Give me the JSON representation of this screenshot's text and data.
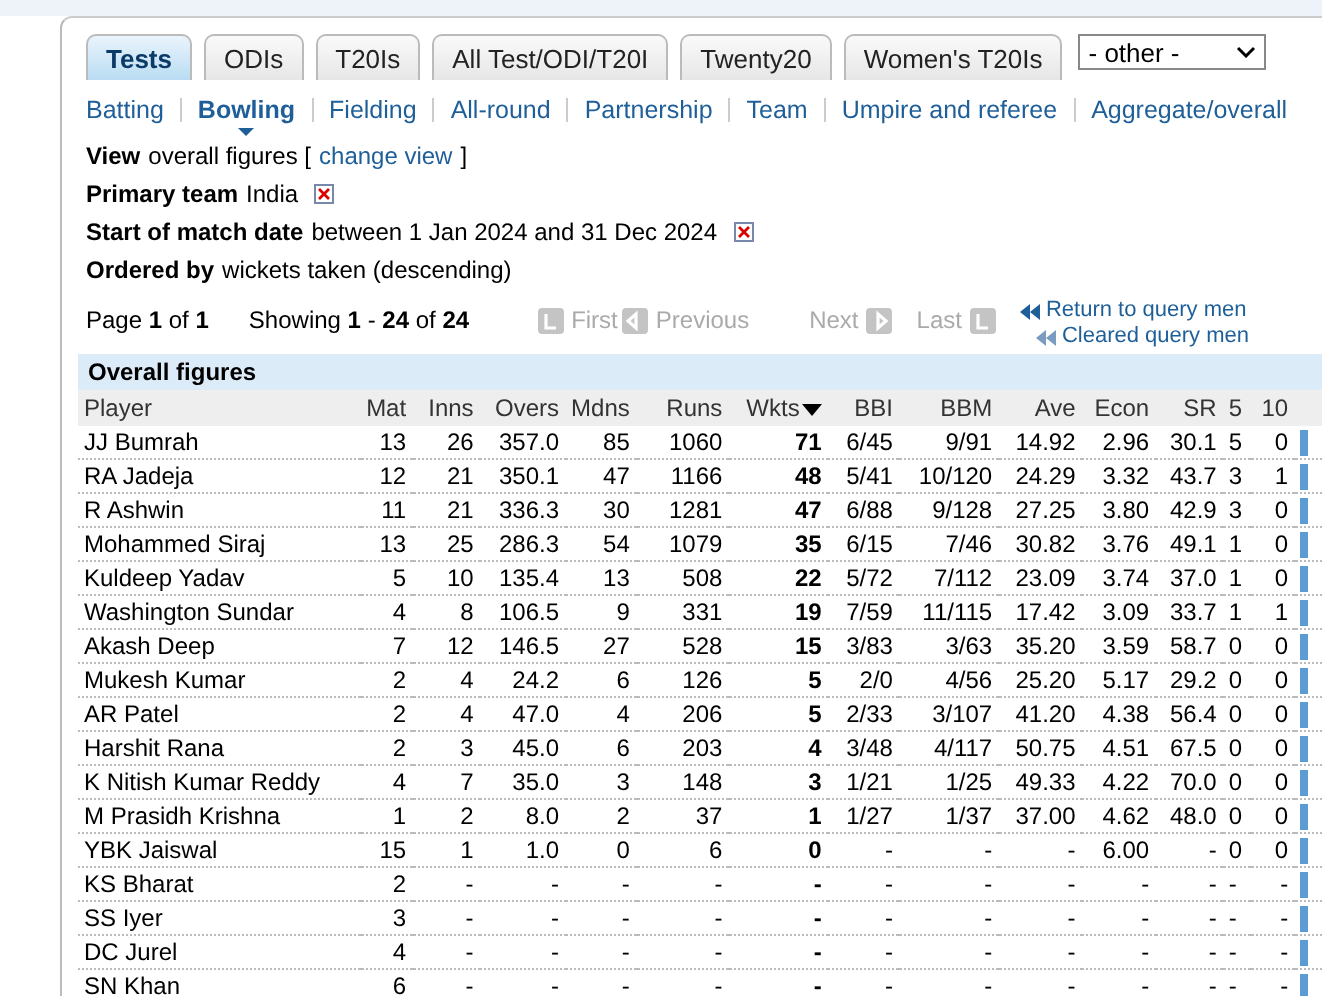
{
  "tabs": [
    {
      "label": "Tests",
      "selected": true
    },
    {
      "label": "ODIs",
      "selected": false
    },
    {
      "label": "T20Is",
      "selected": false
    },
    {
      "label": "All Test/ODI/T20I",
      "selected": false
    },
    {
      "label": "Twenty20",
      "selected": false
    },
    {
      "label": "Women's T20Is",
      "selected": false
    }
  ],
  "other_select": {
    "value": "- other -"
  },
  "nav": [
    {
      "label": "Batting",
      "selected": false
    },
    {
      "label": "Bowling",
      "selected": true
    },
    {
      "label": "Fielding",
      "selected": false
    },
    {
      "label": "All-round",
      "selected": false
    },
    {
      "label": "Partnership",
      "selected": false
    },
    {
      "label": "Team",
      "selected": false
    },
    {
      "label": "Umpire and referee",
      "selected": false
    },
    {
      "label": "Aggregate/overall",
      "selected": false
    }
  ],
  "filters": [
    {
      "label": "View",
      "value": "overall figures [",
      "link": "change view",
      "suffix": "]",
      "removable": false
    },
    {
      "label": "Primary team",
      "value": "India",
      "removable": true
    },
    {
      "label": "Start of match date",
      "value": "between 1 Jan 2024 and 31 Dec 2024",
      "removable": true
    },
    {
      "label": "Ordered by",
      "value": "wickets taken (descending)",
      "removable": false
    }
  ],
  "pagination": {
    "page": "Page **1** of **1**",
    "showing": "Showing **1** - **24** of **24**",
    "first": "First",
    "previous": "Previous",
    "next": "Next",
    "last": "Last"
  },
  "query_links": [
    "Return to query men",
    "Cleared query men"
  ],
  "table": {
    "title": "Overall figures",
    "columns": [
      {
        "label": "Player",
        "sorted": false
      },
      {
        "label": "Mat",
        "sorted": false
      },
      {
        "label": "Inns",
        "sorted": false
      },
      {
        "label": "Overs",
        "sorted": false
      },
      {
        "label": "Mdns",
        "sorted": false
      },
      {
        "label": "Runs",
        "sorted": false
      },
      {
        "label": "Wkts",
        "sorted": true
      },
      {
        "label": "BBI",
        "sorted": false
      },
      {
        "label": "BBM",
        "sorted": false
      },
      {
        "label": "Ave",
        "sorted": false
      },
      {
        "label": "Econ",
        "sorted": false
      },
      {
        "label": "SR",
        "sorted": false
      },
      {
        "label": "5",
        "sorted": false
      },
      {
        "label": "10",
        "sorted": false
      }
    ],
    "rows": [
      [
        "JJ Bumrah",
        "13",
        "26",
        "357.0",
        "85",
        "1060",
        "71",
        "6/45",
        "9/91",
        "14.92",
        "2.96",
        "30.1",
        "5",
        "0"
      ],
      [
        "RA Jadeja",
        "12",
        "21",
        "350.1",
        "47",
        "1166",
        "48",
        "5/41",
        "10/120",
        "24.29",
        "3.32",
        "43.7",
        "3",
        "1"
      ],
      [
        "R Ashwin",
        "11",
        "21",
        "336.3",
        "30",
        "1281",
        "47",
        "6/88",
        "9/128",
        "27.25",
        "3.80",
        "42.9",
        "3",
        "0"
      ],
      [
        "Mohammed Siraj",
        "13",
        "25",
        "286.3",
        "54",
        "1079",
        "35",
        "6/15",
        "7/46",
        "30.82",
        "3.76",
        "49.1",
        "1",
        "0"
      ],
      [
        "Kuldeep Yadav",
        "5",
        "10",
        "135.4",
        "13",
        "508",
        "22",
        "5/72",
        "7/112",
        "23.09",
        "3.74",
        "37.0",
        "1",
        "0"
      ],
      [
        "Washington Sundar",
        "4",
        "8",
        "106.5",
        "9",
        "331",
        "19",
        "7/59",
        "11/115",
        "17.42",
        "3.09",
        "33.7",
        "1",
        "1"
      ],
      [
        "Akash Deep",
        "7",
        "12",
        "146.5",
        "27",
        "528",
        "15",
        "3/83",
        "3/63",
        "35.20",
        "3.59",
        "58.7",
        "0",
        "0"
      ],
      [
        "Mukesh Kumar",
        "2",
        "4",
        "24.2",
        "6",
        "126",
        "5",
        "2/0",
        "4/56",
        "25.20",
        "5.17",
        "29.2",
        "0",
        "0"
      ],
      [
        "AR Patel",
        "2",
        "4",
        "47.0",
        "4",
        "206",
        "5",
        "2/33",
        "3/107",
        "41.20",
        "4.38",
        "56.4",
        "0",
        "0"
      ],
      [
        "Harshit Rana",
        "2",
        "3",
        "45.0",
        "6",
        "203",
        "4",
        "3/48",
        "4/117",
        "50.75",
        "4.51",
        "67.5",
        "0",
        "0"
      ],
      [
        "K Nitish Kumar Reddy",
        "4",
        "7",
        "35.0",
        "3",
        "148",
        "3",
        "1/21",
        "1/25",
        "49.33",
        "4.22",
        "70.0",
        "0",
        "0"
      ],
      [
        "M Prasidh Krishna",
        "1",
        "2",
        "8.0",
        "2",
        "37",
        "1",
        "1/27",
        "1/37",
        "37.00",
        "4.62",
        "48.0",
        "0",
        "0"
      ],
      [
        "YBK Jaiswal",
        "15",
        "1",
        "1.0",
        "0",
        "6",
        "0",
        "-",
        "-",
        "-",
        "6.00",
        "-",
        "0",
        "0"
      ],
      [
        "KS Bharat",
        "2",
        "-",
        "-",
        "-",
        "-",
        "-",
        "-",
        "-",
        "-",
        "-",
        "-",
        "-",
        "-"
      ],
      [
        "SS Iyer",
        "3",
        "-",
        "-",
        "-",
        "-",
        "-",
        "-",
        "-",
        "-",
        "-",
        "-",
        "-",
        "-"
      ],
      [
        "DC Jurel",
        "4",
        "-",
        "-",
        "-",
        "-",
        "-",
        "-",
        "-",
        "-",
        "-",
        "-",
        "-",
        "-"
      ],
      [
        "SN Khan",
        "6",
        "-",
        "-",
        "-",
        "-",
        "-",
        "-",
        "-",
        "-",
        "-",
        "-",
        "-",
        "-"
      ]
    ]
  }
}
